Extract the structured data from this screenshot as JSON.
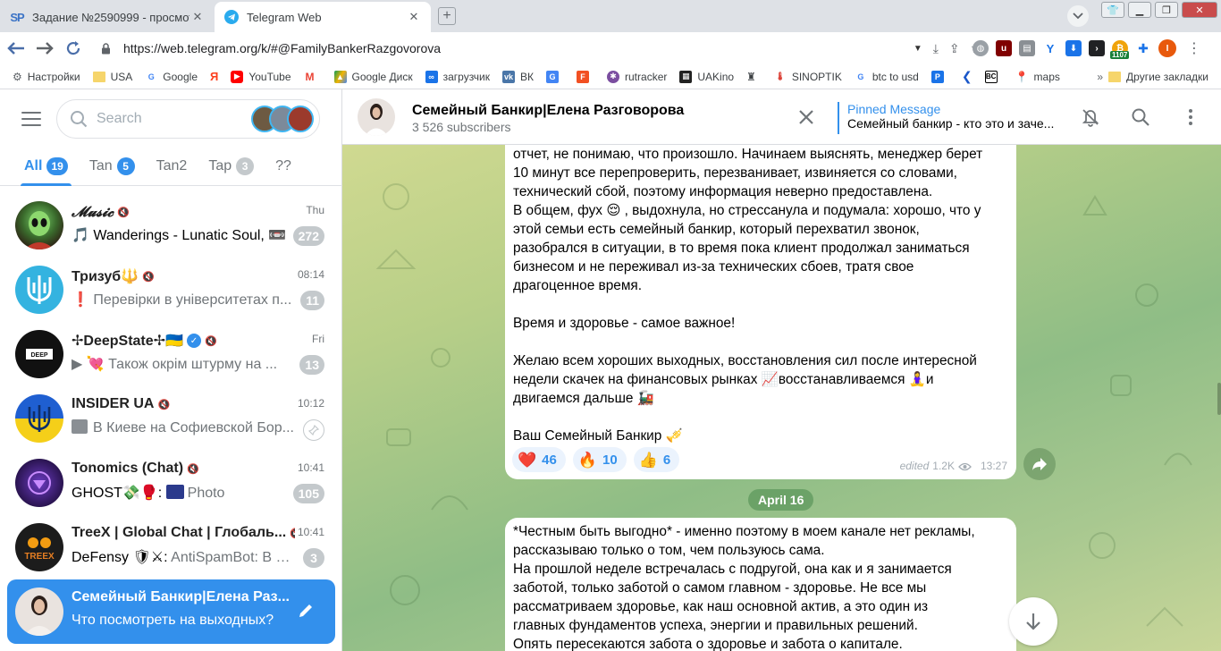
{
  "browser": {
    "tabs": [
      {
        "title": "Задание №2590999 - просмотр з",
        "favicon": "SP"
      },
      {
        "title": "Telegram Web",
        "favicon": "telegram-icon"
      }
    ],
    "url": "https://web.telegram.org/k/#@FamilyBankerRazgovorova",
    "ext_badge": "1107",
    "profile_letter": "I",
    "bookmarks": [
      "Настройки",
      "USA",
      "Google",
      "Я",
      "YouTube",
      "Gmail",
      "Google Диск",
      "загрузчик",
      "ВК",
      "Переводчик",
      "F",
      "rutracker",
      "UAKino",
      "Weather",
      "SINOPTIK",
      "btc to usd",
      "P",
      "Kyivstar",
      "BC",
      "maps"
    ],
    "bookmarks_other": "Другие закладки",
    "bookmarks_more": "»"
  },
  "sidebar": {
    "search_placeholder": "Search",
    "folders": [
      {
        "label": "All",
        "count": "19",
        "active": true
      },
      {
        "label": "Tan",
        "count": "5",
        "muted": false
      },
      {
        "label": "Tan2",
        "count": "",
        "muted": false
      },
      {
        "label": "Tap",
        "count": "3",
        "muted": true
      },
      {
        "label": "??",
        "count": "",
        "muted": false
      }
    ],
    "chats": [
      {
        "title": "𝓜𝓾𝓼𝓲𝓬",
        "time": "Thu",
        "preview": "🎵 Wanderings - Lunatic Soul, 📼",
        "unread": "272"
      },
      {
        "title": "Тризуб🔱",
        "time": "08:14",
        "preview": "❗ Перевірки в університетах п...",
        "unread": "11"
      },
      {
        "title": "✢DeepState✢🇺🇦",
        "time": "Fri",
        "preview": "▶ 💘 Також окрім штурму на ...",
        "unread": "13"
      },
      {
        "title": "INSIDER UA",
        "time": "10:12",
        "preview": "В Киеве на Софиевской Бор...",
        "unread": ""
      },
      {
        "title": "Tonomics (Chat)",
        "time": "10:41",
        "preview_sender": "GHOST💸🥊:",
        "preview": "Photo",
        "unread": "105"
      },
      {
        "title": "TreeX | Global Chat | Глобаль...",
        "time": "10:41",
        "preview_sender": "DeFensy 🛡⚔:",
        "preview": "AntiSpamBot: В ча...",
        "unread": "3"
      },
      {
        "title": "Семейный Банкир|Елена Раз...",
        "time": "",
        "preview": "Что посмотреть на выходных?",
        "unread": ""
      }
    ]
  },
  "channel": {
    "title": "Семейный Банкир|Елена Разговорова",
    "subscribers": "3 526 subscribers",
    "pinned_label": "Pinned Message",
    "pinned_text": "Семейный банкир - кто это и заче..."
  },
  "messages": {
    "m1": {
      "lines": [
        "отчет, не понимаю, что произошло. Начинаем выяснять, менеджер берет",
        "10 минут все перепроверить, перезванивает, извиняется со словами,",
        "технический сбой, поэтому информация неверно предоставлена.",
        "В общем, фух 😌 , выдохнула, но стрессанула и подумала: хорошо, что у",
        "этой семьи есть семейный банкир, который перехватил звонок,",
        "разобрался в ситуации, в то время пока клиент продолжал заниматься",
        "бизнесом и не переживал из-за технических сбоев, тратя свое",
        "драгоценное время.",
        "",
        "Время и здоровье - самое важное!",
        "",
        "Желаю всем хороших выходных, восстановления сил после интересной",
        "недели скачек на финансовых рынках 📈восстанавливаемся 🧘‍♀️и",
        "двигаемся дальше 🚂",
        "",
        "Ваш Семейный Банкир 🎺"
      ],
      "reactions": [
        {
          "emoji": "❤️",
          "count": "46"
        },
        {
          "emoji": "🔥",
          "count": "10"
        },
        {
          "emoji": "👍",
          "count": "6"
        }
      ],
      "edited": "edited",
      "views": "1.2K",
      "time": "13:27"
    },
    "date_divider": "April 16",
    "m2": {
      "lines": [
        "*Честным быть выгодно* - именно поэтому в моем канале нет рекламы,",
        "рассказываю только о том, чем пользуюсь сама.",
        "На прошлой неделе встречалась с подругой, она как и я занимается",
        "заботой, только заботой о самом главном - здоровье. Не все мы",
        "рассматриваем здоровье, как наш основной актив, а это один из",
        "главных фундаментов  успеха, энергии и правильных решений.",
        "Опять пересекаются забота о здоровье и забота о капитале."
      ]
    }
  }
}
